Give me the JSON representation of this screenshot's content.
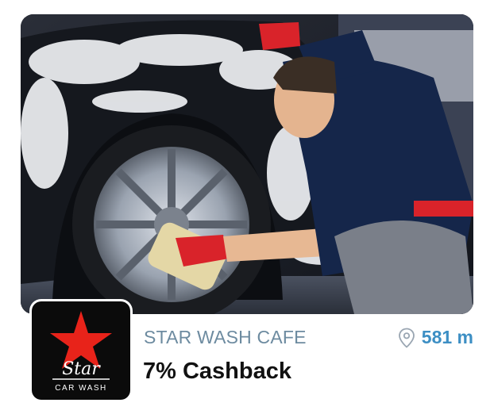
{
  "hero": {
    "image_icon": "car-wash-photo"
  },
  "merchant": {
    "logo_brand": "Star",
    "logo_tagline": "CAR WASH",
    "logo_icon": "red-star-icon",
    "logo_star_color": "#e8231a",
    "name": "STAR WASH CAFE",
    "offer": "7% Cashback",
    "distance": "581 m",
    "distance_icon": "location-pin-icon",
    "accent_color": "#3d8fc4"
  }
}
